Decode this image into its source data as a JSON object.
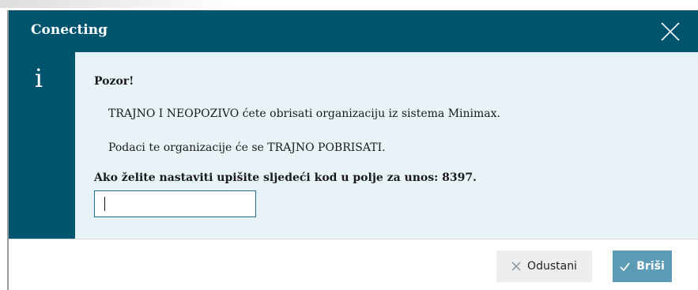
{
  "dialog": {
    "title": "Conecting",
    "info_symbol": "i",
    "heading": "Pozor!",
    "line1": "TRAJNO I NEOPOZIVO ćete obrisati organizaciju iz sistema Minimax.",
    "line2": "Podaci te organizacije će se TRAJNO POBRISATI.",
    "instruction": "Ako želite nastaviti upišite sljedeći kod u polje za unos: 8397.",
    "code_input": {
      "value": "",
      "placeholder": ""
    },
    "buttons": {
      "cancel_label": "Odustani",
      "delete_label": "Briši"
    }
  },
  "colors": {
    "header": "#00546e",
    "content_bg": "#e8f3f8",
    "primary_button": "#5c9bb5",
    "secondary_button": "#eceeef"
  },
  "icons": {
    "close": "close-icon",
    "info": "info-icon",
    "cancel": "x-icon",
    "confirm": "checkmark-icon"
  }
}
